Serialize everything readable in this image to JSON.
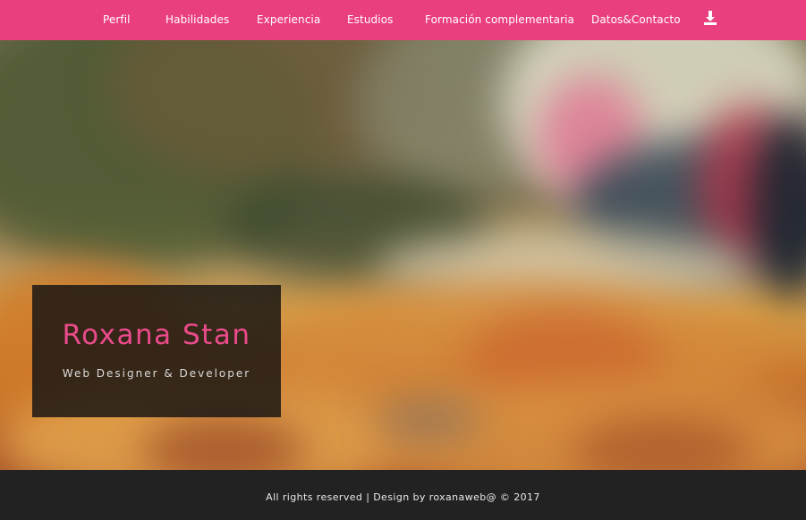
{
  "nav": {
    "items": [
      {
        "label": "Perfil"
      },
      {
        "label": "Habilidades"
      },
      {
        "label": "Experiencia"
      },
      {
        "label": "Estudios"
      },
      {
        "label": "Formación complementaria"
      },
      {
        "label": "Datos&Contacto"
      }
    ],
    "download_icon": "download-icon"
  },
  "hero": {
    "name": "Roxana Stan",
    "subtitle": "Web Designer & Developer"
  },
  "footer": {
    "text": "All rights reserved | Design by roxanaweb@ © 2017"
  },
  "colors": {
    "accent": "#ea3f7f",
    "name_pink": "#ea4b8b",
    "footer_bg": "#222222"
  }
}
